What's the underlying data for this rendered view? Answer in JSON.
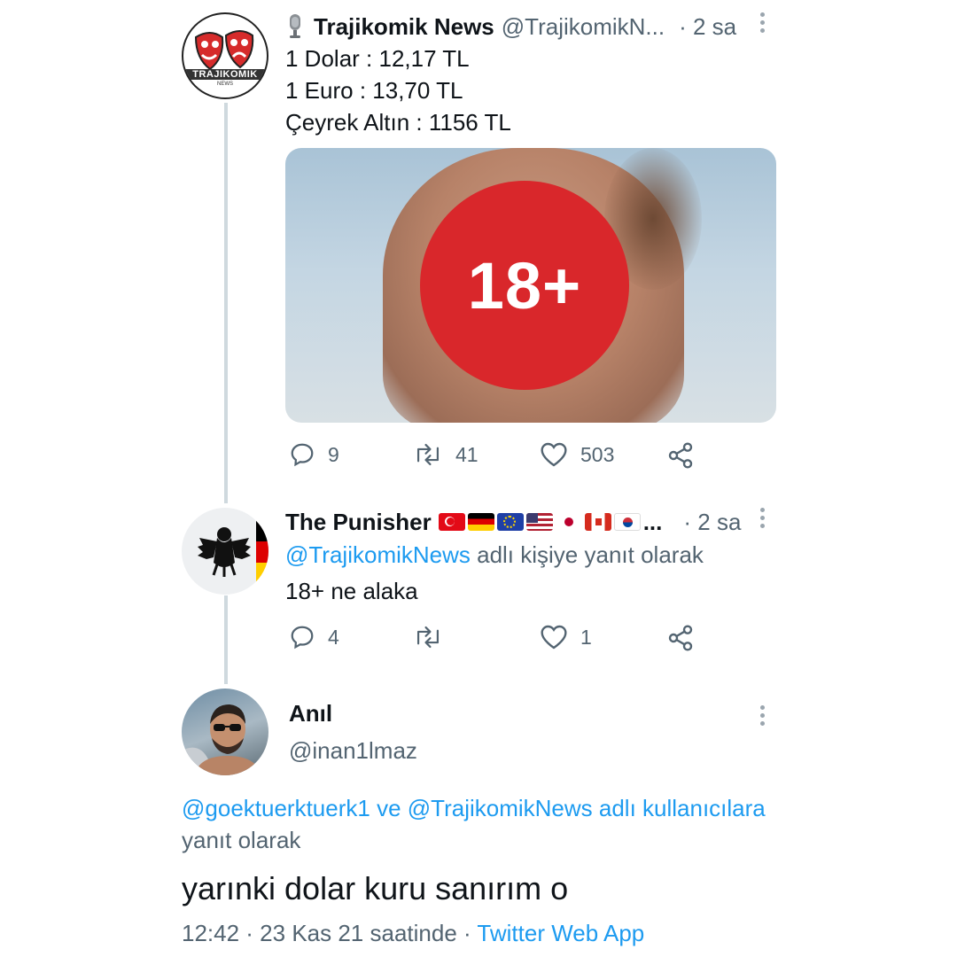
{
  "tweet1": {
    "author_name": "Trajikomik News",
    "author_handle": "@TrajikomikN...",
    "time": "· 2 sa",
    "avatar_text": "TRAJIKOMIK",
    "avatar_subtext": "NEWS",
    "lines": [
      "1 Dolar : 12,17 TL",
      "1 Euro : 13,70 TL",
      "Çeyrek Altın : 1156 TL"
    ],
    "media_badge": "18+",
    "replies": "9",
    "retweets": "41",
    "likes": "503"
  },
  "tweet2": {
    "author_name": "The Punisher",
    "flags_ellipsis": "...",
    "time": "· 2 sa",
    "reply_to_handle": "@TrajikomikNews",
    "reply_to_suffix": " adlı kişiye yanıt olarak",
    "text": "18+ ne alaka",
    "replies": "4",
    "retweets": "",
    "likes": "1"
  },
  "tweet3": {
    "author_name": "Anıl",
    "author_handle": "@inan1lmaz",
    "reply_mention_1": "@goektuerktuerk1",
    "reply_conj": " ve ",
    "reply_mention_2": "@TrajikomikNews",
    "reply_suffix": " adlı kullanıcılara",
    "reply_line2": "yanıt olarak",
    "text": "yarınki dolar kuru sanırım o",
    "timestamp": "12:42 · 23 Kas 21 saatinde · ",
    "source": "Twitter Web App"
  },
  "colors": {
    "link": "#1d9bf0",
    "badge_red": "#d9272b",
    "meta_gray": "#536471"
  }
}
